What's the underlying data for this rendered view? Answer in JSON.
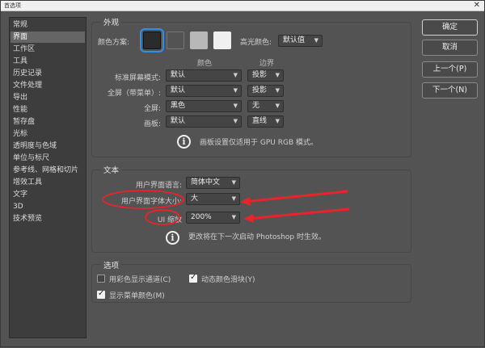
{
  "window": {
    "title": "首选项",
    "close_glyph": "✕"
  },
  "sidebar": {
    "items": [
      {
        "label": "常规"
      },
      {
        "label": "界面",
        "selected": true
      },
      {
        "label": "工作区"
      },
      {
        "label": "工具"
      },
      {
        "label": "历史记录"
      },
      {
        "label": "文件处理"
      },
      {
        "label": "导出"
      },
      {
        "label": "性能"
      },
      {
        "label": "暂存盘"
      },
      {
        "label": "光标"
      },
      {
        "label": "透明度与色域"
      },
      {
        "label": "单位与标尺"
      },
      {
        "label": "参考线、网格和切片"
      },
      {
        "label": "增效工具"
      },
      {
        "label": "文字"
      },
      {
        "label": "3D"
      },
      {
        "label": "技术预览"
      }
    ]
  },
  "appearance": {
    "title": "外观",
    "color_scheme_label": "颜色方案:",
    "swatches": [
      "#2b2b2b",
      "#535353",
      "#b8b8b8",
      "#f0f0f0"
    ],
    "highlight_label": "高光颜色:",
    "highlight_value": "默认值",
    "col_color": "颜色",
    "col_border": "边界",
    "rows": [
      {
        "label": "标准屏幕模式:",
        "color": "默认",
        "border": "投影"
      },
      {
        "label": "全屏（带菜单）:",
        "color": "默认",
        "border": "投影"
      },
      {
        "label": "全屏:",
        "color": "黑色",
        "border": "无"
      },
      {
        "label": "画板:",
        "color": "默认",
        "border": "直线"
      }
    ],
    "info_glyph": "i",
    "info_text": "画板设置仅适用于 GPU RGB 模式。"
  },
  "text": {
    "title": "文本",
    "ui_language_label": "用户界面语言:",
    "ui_language_value": "简体中文",
    "ui_font_size_label": "用户界面字体大小:",
    "ui_font_size_value": "大",
    "ui_scale_label": "UI 缩放",
    "ui_scale_value": "200%",
    "info_glyph": "i",
    "info_text": "更改将在下一次启动 Photoshop 时生效。"
  },
  "options": {
    "title": "选项",
    "checkboxes": [
      {
        "label": "用彩色显示通道(C)",
        "checked": false
      },
      {
        "label": "动态颜色滑块(Y)",
        "checked": true
      },
      {
        "label": "显示菜单颜色(M)",
        "checked": true
      }
    ]
  },
  "buttons": {
    "ok": "确定",
    "cancel": "取消",
    "prev": "上一个(P)",
    "next": "下一个(N)"
  },
  "annotation_color": "#e8232a",
  "accent_color": "#2f8fe6"
}
